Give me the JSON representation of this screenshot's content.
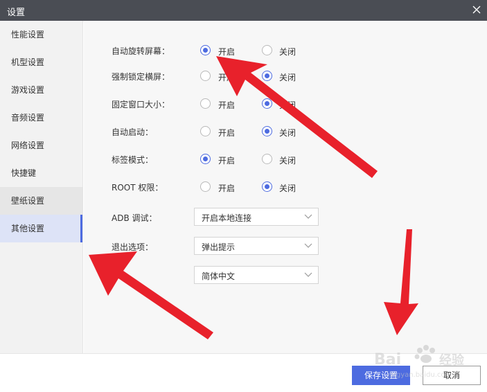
{
  "window": {
    "title": "设置"
  },
  "sidebar": {
    "items": [
      {
        "label": "性能设置"
      },
      {
        "label": "机型设置"
      },
      {
        "label": "游戏设置"
      },
      {
        "label": "音频设置"
      },
      {
        "label": "网络设置"
      },
      {
        "label": "快捷键"
      },
      {
        "label": "壁纸设置"
      },
      {
        "label": "其他设置"
      }
    ],
    "active_index": 7
  },
  "settings": {
    "radio_rows": [
      {
        "label": "自动旋转屏幕：",
        "on_label": "开启",
        "off_label": "关闭",
        "selected": "开启"
      },
      {
        "label": "强制锁定横屏：",
        "on_label": "开启",
        "off_label": "关闭",
        "selected": "关闭"
      },
      {
        "label": "固定窗口大小：",
        "on_label": "开启",
        "off_label": "关闭",
        "selected": "关闭"
      },
      {
        "label": "自动启动：",
        "on_label": "开启",
        "off_label": "关闭",
        "selected": "关闭"
      },
      {
        "label": "标签模式：",
        "on_label": "开启",
        "off_label": "关闭",
        "selected": "开启"
      },
      {
        "label": "ROOT 权限：",
        "on_label": "开启",
        "off_label": "关闭",
        "selected": "关闭"
      }
    ],
    "adb": {
      "label": "ADB 调试：",
      "value": "开启本地连接"
    },
    "exit": {
      "label": "退出选项：",
      "value": "弹出提示"
    },
    "language": {
      "value": "简体中文"
    }
  },
  "footer": {
    "save_label": "保存设置",
    "cancel_label": "取消"
  },
  "colors": {
    "accent": "#4d6be0",
    "arrow": "#e8212b",
    "titlebar": "#4a4d54"
  },
  "watermark": {
    "text": "Bai经验",
    "sub": "jingyan.baidu.com"
  }
}
